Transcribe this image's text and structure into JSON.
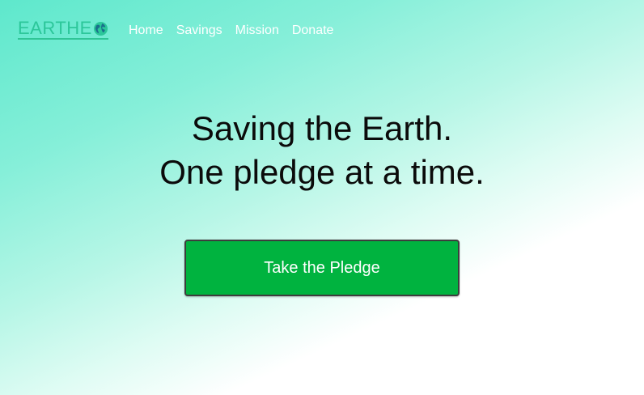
{
  "nav": {
    "logo_text": "EARTHE",
    "logo_icon": "globe-icon",
    "links": [
      {
        "label": "Home"
      },
      {
        "label": "Savings"
      },
      {
        "label": "Mission"
      },
      {
        "label": "Donate"
      }
    ]
  },
  "hero": {
    "line1": "Saving the Earth.",
    "line2": "One pledge at a time."
  },
  "cta": {
    "label": "Take the Pledge"
  },
  "colors": {
    "accent": "#00b33f",
    "logo": "#2cc79a",
    "gradient_start": "#5ee8cc",
    "gradient_end": "#ffffff"
  }
}
